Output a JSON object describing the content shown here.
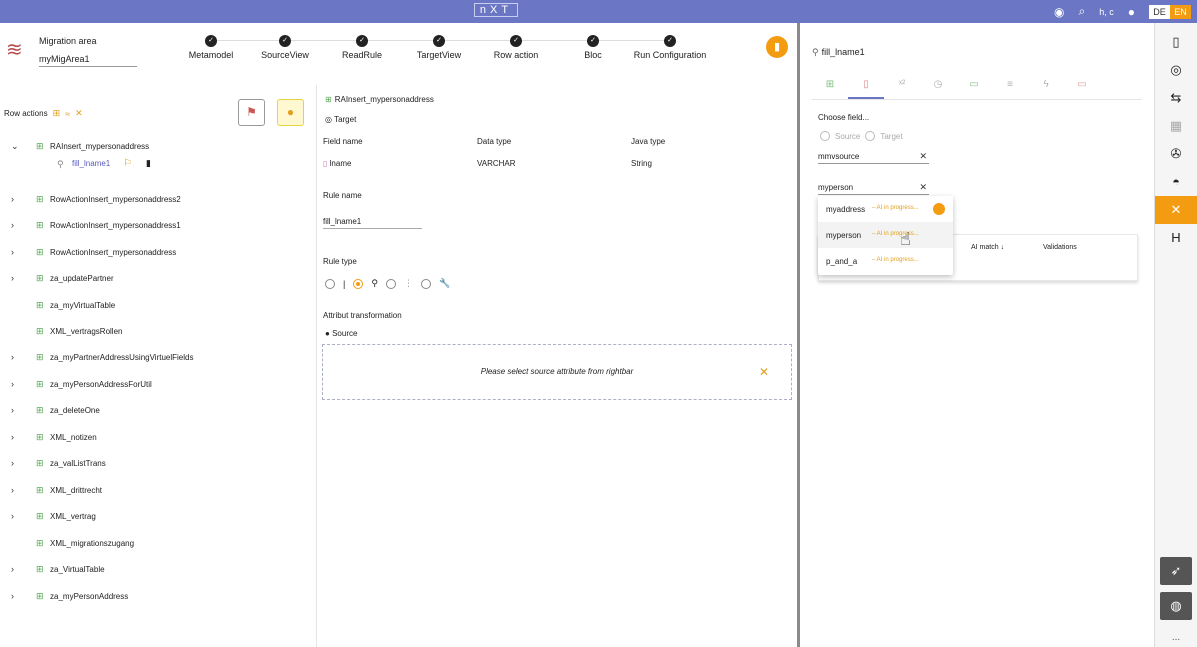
{
  "topbar": {
    "logo": "nXT",
    "user": "h, c",
    "lang_de": "DE",
    "lang_en": "EN",
    "icons": [
      "eye-mask-icon",
      "search-icon",
      "user-icon"
    ]
  },
  "header": {
    "migration_label": "Migration area",
    "migration_value": "myMigArea1",
    "steps": [
      "Metamodel",
      "SourceView",
      "ReadRule",
      "TargetView",
      "Row action",
      "Bloc",
      "Run Configuration"
    ]
  },
  "left": {
    "row_actions_label": "Row actions",
    "tree": [
      {
        "label": "RAInsert_mypersonaddress",
        "expandable": true,
        "expanded": true
      },
      {
        "label": "RowActionInsert_mypersonaddress2",
        "expandable": true
      },
      {
        "label": "RowActionInsert_mypersonaddress1",
        "expandable": true
      },
      {
        "label": "RowActionInsert_mypersonaddress",
        "expandable": true
      },
      {
        "label": "za_updatePartner",
        "expandable": true
      },
      {
        "label": "za_myVirtualTable",
        "expandable": false
      },
      {
        "label": "XML_vertragsRollen",
        "expandable": false
      },
      {
        "label": "za_myPartnerAddressUsingVirtuelFields",
        "expandable": true
      },
      {
        "label": "za_myPersonAddressForUtil",
        "expandable": true
      },
      {
        "label": "za_deleteOne",
        "expandable": true
      },
      {
        "label": "XML_notizen",
        "expandable": true
      },
      {
        "label": "za_valListTrans",
        "expandable": true
      },
      {
        "label": "XML_drittrecht",
        "expandable": true
      },
      {
        "label": "XML_vertrag",
        "expandable": true
      },
      {
        "label": "XML_migrationszugang",
        "expandable": false
      },
      {
        "label": "za_VirtualTable",
        "expandable": true
      },
      {
        "label": "za_myPersonAddress",
        "expandable": true
      }
    ],
    "sub_item": "fill_lname1"
  },
  "middle": {
    "title": "RAInsert_mypersonaddress",
    "target_label": "Target",
    "col_field": "Field name",
    "col_type": "Data type",
    "col_java": "Java type",
    "row_field": "lname",
    "row_type": "VARCHAR",
    "row_java": "String",
    "rule_name_label": "Rule name",
    "rule_name_value": "fill_lname1",
    "rule_type_label": "Rule type",
    "attr_transform_label": "Attribut transformation",
    "source_label": "Source",
    "drop_hint": "Please select source attribute from rightbar"
  },
  "right": {
    "title": "fill_lname1",
    "choose_label": "Choose field...",
    "radio_source": "Source",
    "radio_target": "Target",
    "field1": "mmvsource",
    "field2": "myperson",
    "table_cols": [
      "AI match ↓",
      "Validations"
    ],
    "dropdown": [
      {
        "label": "myaddress",
        "status": "– AI in progress..."
      },
      {
        "label": "myperson",
        "status": "– AI in progress..."
      },
      {
        "label": "p_and_a",
        "status": "– AI in progress..."
      }
    ]
  },
  "sidebar": {
    "icons": [
      "book-icon",
      "compass-icon",
      "flow-icon",
      "chart-icon",
      "aperture-icon",
      "helmet-icon",
      "tools-icon",
      "h-icon",
      "rocket-icon",
      "gamepad-icon"
    ],
    "more": "..."
  },
  "colors": {
    "topbar": "#6b77c5",
    "accent": "#f39c12",
    "table_icon": "#5aa55a"
  }
}
